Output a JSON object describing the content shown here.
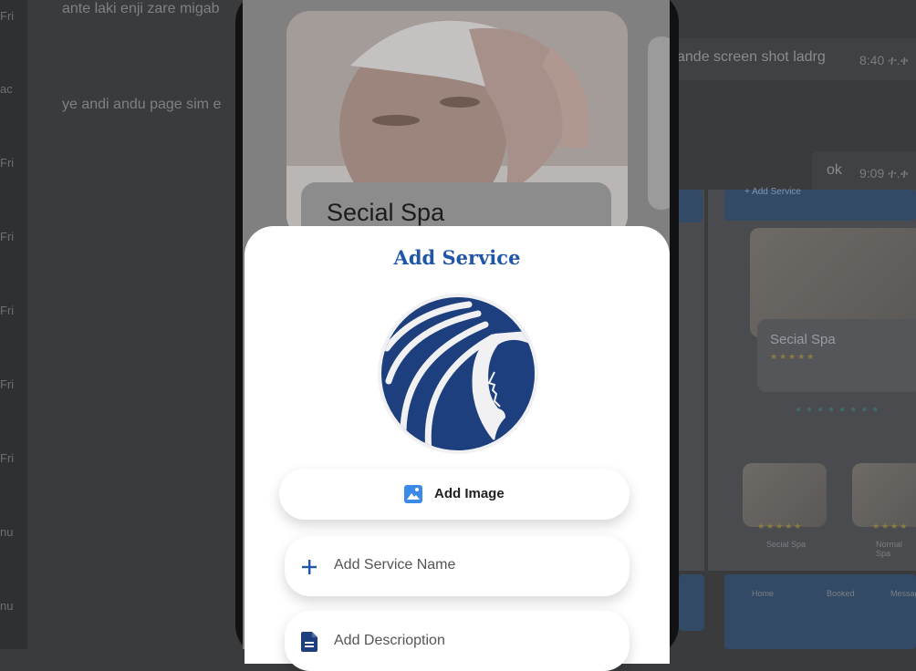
{
  "background_chat": {
    "left_labels": [
      "Fri",
      "ac",
      "Fri",
      "Fri",
      "Fri",
      "Fri",
      "Fri",
      "nu",
      "nu"
    ],
    "messages": [
      {
        "text": "ante laki enji zare migab"
      },
      {
        "text": "ye andi andu page sim e"
      }
    ],
    "right_messages": [
      {
        "text": "ande screen shot ladrg",
        "time": "8:40 ተ.ቀ"
      },
      {
        "text": "ok",
        "time": "9:09 ተ.ቀ"
      }
    ]
  },
  "background_screenshot": {
    "card_title": "Secial Spa",
    "add_label": "+ Add Service",
    "small_items": [
      "Secial Spa",
      "Normal Spa"
    ],
    "tabs": [
      "Home",
      "Booked",
      "Messages"
    ]
  },
  "phone": {
    "card": {
      "title": "Secial Spa"
    }
  },
  "sheet": {
    "title": "Add Service",
    "add_image_label": "Add Image",
    "fields": [
      {
        "placeholder": "Add Service Name",
        "icon": "plus-icon"
      },
      {
        "placeholder": "Add Descrioption",
        "icon": "description-icon"
      }
    ]
  },
  "colors": {
    "accent": "#1f56a8",
    "logo_navy": "#1d3f7e",
    "add_image_icon": "#3b8ae8"
  }
}
